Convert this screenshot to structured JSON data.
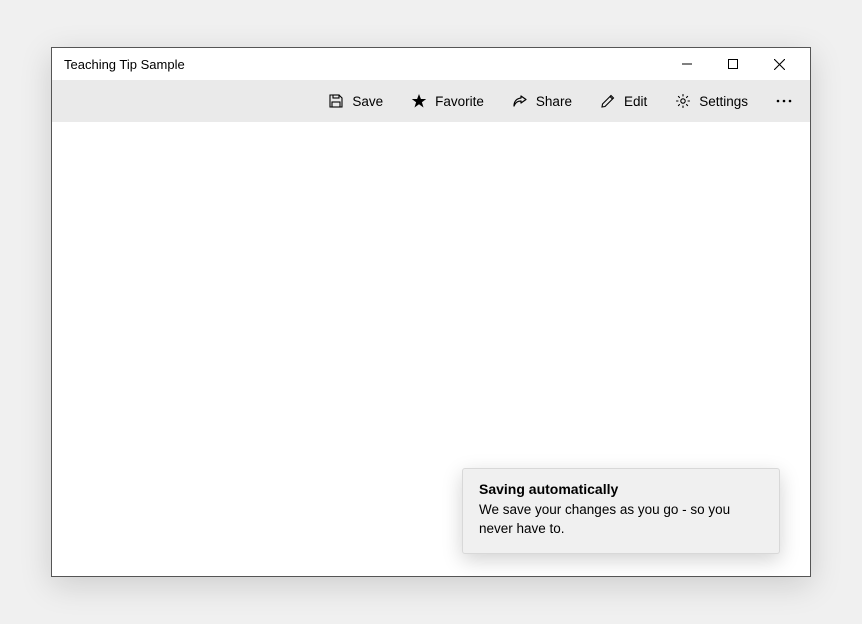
{
  "window": {
    "title": "Teaching Tip Sample"
  },
  "commandbar": {
    "save": "Save",
    "favorite": "Favorite",
    "share": "Share",
    "edit": "Edit",
    "settings": "Settings"
  },
  "teaching_tip": {
    "title": "Saving automatically",
    "body": "We save your changes as you go - so you never have to."
  }
}
